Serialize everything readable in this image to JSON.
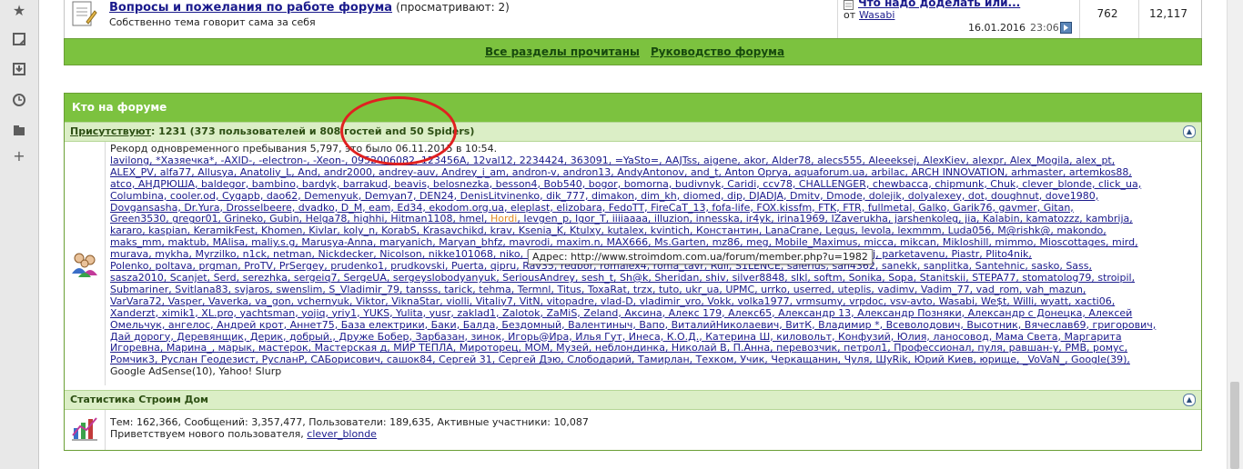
{
  "forum_row": {
    "title": "Вопросы и пожелания по работе форума",
    "viewing": "(просматривают: 2)",
    "description": "Собственно тема говорит сама за себя",
    "last_post_title": "Что надо доделать или...",
    "last_post_by_prefix": "от",
    "last_post_author": "Wasabi",
    "last_post_date": "16.01.2016",
    "last_post_time": "23:06",
    "topics": "762",
    "posts": "12,117"
  },
  "links_bar": {
    "mark_read": "Все разделы прочитаны",
    "guide": "Руководство форума"
  },
  "who_online": {
    "title": "Кто на форуме",
    "present_label": "Присутствуют",
    "present_text": ": 1231 (373 пользователей и 808 гостей and 50 Spiders)",
    "record_text": "Рекорд одновременного пребывания 5,797, это было 06.11.2015 в 10:54.",
    "users_lines": [
      "lavilong, *Хазяечка*, -AXID-, -electron-, -Xeon-, 0952006082, 123456A, 12val12, 2234424, 363091, =YaSto=, AAJTss, aigene, akor, Alder78, alecs555, Aleeeksej, AlexKiev, alexpr, Alex_Mogila, alex_pt,",
      "ALEX_PV, alfa77, Allusya, Anatoliy_L, And, andr2000, andrey-auv, Andrey_i_am, andron-v, andron13, AndyAntonov, and_t, Anton Oprya, aquaforum.ua, arbilac, ARCH INNOVATION, arhmaster, artemkos88,",
      "atco, АНДРЮША, baldegor, bambino, bardyk, barrakud, beavis, belosnezka, besson4, Bob540, bogor, bomorna, budivnyk, Caridi, ccv78, CHALLENGER, chewbaсса, chipmunk, Chuk, clever_blonde, click_ua,",
      "Columbina, cooler.od, Cygapb, dao62, Demenyuk, Demyan7, DEN24, DenisLitvinenko, dik_777, dimakon, dim_kh, diomed, dip, DJADJA, Dmitv, Dmode, dolejik, dolyalexey, dot, doughnut, dove1980,",
      "Dovgansasha, Dr.Yura, Drosselbeere, dvadko, D_M, eam, Ed34, ekodom.org.ua, eleplast, elizobara, FedoTT, FireCaT_13, fofa-life, FOX.kissfm, FTK, FTR, fullmetal, Galko, Garik76, gavmer, Gitan,",
      "Green3530, gregor01, Grineko, Gubin, Helga78, highhi, Hitman1108, hmel, Hordi, Ievgen_p, Igor_T, iiiiaaaa, illuzion, innesska, ir4yk, irina1969, IZaverukha, jarshenkoleg, jia, Kalabin, kamatozzz, kambrija,",
      "kararo, kaspian, KeramikFest, Khomen, Kivlar, koly_n, KorabS, Krasavchikd, krav, Ksenia_K, Ktulxy, kutalex, kvintich, Константин, LanaCrane, Legus, levola, lexmmm, Luda056, M@rishk@, makondo,",
      "maks_mm, maktub, MAlisa, maliy.s.g, Marusya-Anna, maryanich, Maryan_bhfz, mavrodi, maxim.n, MAX666, Ms.Garten, mz86, meg, Mobile_Maximus, micca, mikcan, Mikloshill, mimmo, Mioscottages, mird,",
      "murava, mykha, Myrzilko, n1ck, netman, Nickdecker, Nicolson, nikke101068, niko, Nikolay, Novgorod, Nulls, NPO, o_o, O.K., OlegB, otoplenie_kiev, Papaj, parketavenu, Piastr, Plito4nik,",
      "Polenko, poltava, prgman, ProTV, PrSergey, prudenko1, prudkovski, Puerta, qipru, Rav35, redbor, romalex4, roma_tavr, Rull, S1LENCE, salerius, san4362, sanekk, sanplitka, Santehnic, sasko, Sass,",
      "sasza2010, Scanjet, Serd, serezhka, sergeiq7, SergeUA, sergeyslobodyanyuk, SeriousAndrey, sesh_t, Sh@k, Sheridan, shiv, silver8848, slkl, softm, Sonika, Sopa, Stanitskii, STEPA77, stomatolog79, stroipil,",
      "Submariner, Svitlana83, svjaros, swenslim, S_Vladimir_79, tansss, tarick, tehma, Termnl, Titus, ToxaRat, trzx, tuto, ukr_ua, UPMC, urrko, userred, uteplis, vadimv, Vadim_77, vad_rom, vah_mazun,",
      "VarVara72, Vasper, Vaverka, va_gon, vchernyuk, Viktor, ViknaStar, violli, Vitaliy7, VitN, vitopadre, vlad-D, vladimir_vro, Vokk, volka1977, vrmsumy, vrpdoc, vsv-avto, Wasabi, We$t, Willi, wyatt, xacti06,",
      "Xanderzt, ximik1, XL.pro, yachtsman, yojiq, yriy1, YUKS, Yulita, yusr, zaklad1, Zalotok, ZaMiS, Zeland, Аксина, Алекс 179, Алекс65, Александр 13, Александр Позняки, Александр с Донецка, Алексей",
      "Омельчук, ангелос, Андрей крот, Аннет75, База електрики, Баки, Балда, Бездомный, Валентиныч, Вапо, ВиталийНиколаевич, ВитК, Владимир *, Всеволодович, Высотник, Вячеслав69, григорович,",
      "Дай дорогу, Деревянщик, Дерик, добрый., Друже Бобер, Зарбазан, зинок, Игорь@Ира, Илья Гут, Инеса, К.О.Д., Катерина Ш, киловольт, Конфузий, Юлия, ланосовод, Мама Света, Маргарита",
      "Игоревна, Марина_, марык, мастерок, Мастерская д, МИР ТЕПЛА, Мироторец, МОМ, Музей, неблондинка, Николай В, П.Анна, перевозчик, петрол1, Профессионал, пуля, равшан-у, PMB, ромус,",
      "Ромчик3, Руслан Геодезист, РусланР, САБорисович, сашок84, Сергей 31, Сергей Дэю, Слободарий, Тамирлан, Техком, Учик, Черкащанин, Чуля, ШуRik, Юрий Киев, юрище, _VoVaN_, Google(39),",
      "Google AdSense(10), Yahoo! Slurp"
    ],
    "tooltip": "Адрес: http://www.stroimdom.com.ua/forum/member.php?u=1982"
  },
  "stats": {
    "title": "Статистика Строим Дом",
    "line1": "Тем: 162,366, Сообщений: 3,357,477, Пользователи: 189,635, Активные участники: 10,087",
    "welcome_prefix": "Приветствуем нового пользователя, ",
    "new_user": "clever_blonde"
  },
  "colors": {
    "header_green": "#7cc23f",
    "sub_green": "#dbeec6",
    "link_blue": "#1a1a8c",
    "highlight_orange": "#e08a23",
    "annotation_red": "#e02020"
  },
  "icons": {
    "sidebar": [
      "star-icon",
      "note-icon",
      "download-icon",
      "clock-icon",
      "folder-icon",
      "plus-icon"
    ],
    "collapse": "collapse-up-icon"
  }
}
